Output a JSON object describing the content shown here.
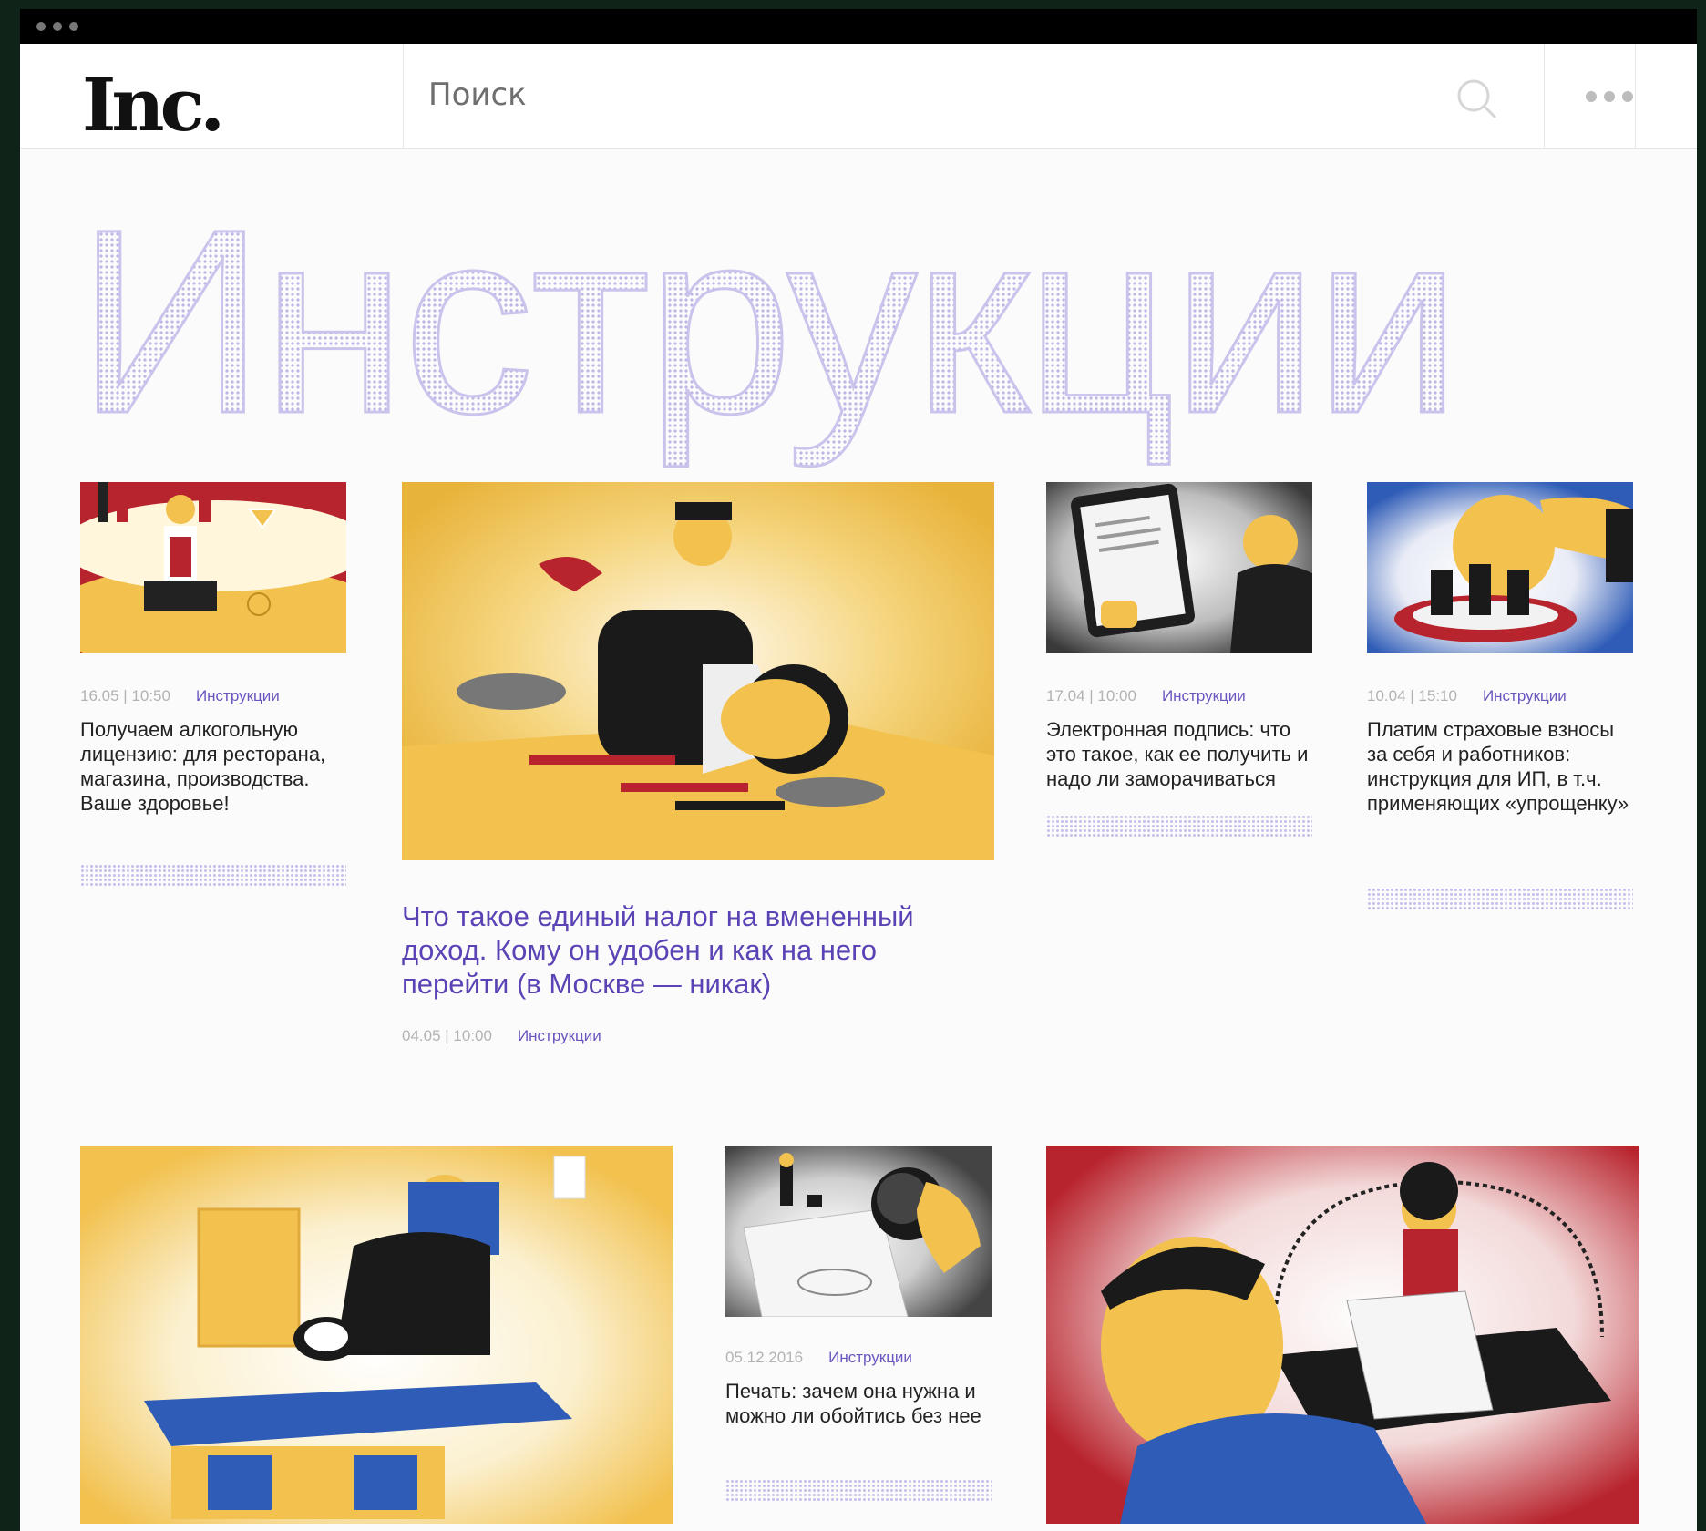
{
  "header": {
    "logo": "Inc.",
    "search_placeholder": "Поиск"
  },
  "hero": {
    "title": "Инструкции"
  },
  "articles": [
    {
      "date": "16.05 | 10:50",
      "category": "Инструкции",
      "title": "Получаем алкогольную лицензию: для ресторана, магазина, производства. Ваше здоровье!"
    },
    {
      "date": "04.05 | 10:00",
      "category": "Инструкции",
      "title": "Что такое единый налог на вмененный доход. Кому он удобен и как на него перейти (в Москве — никак)"
    },
    {
      "date": "17.04 | 10:00",
      "category": "Инструкции",
      "title": "Электронная подпись: что это такое, как ее получить и надо ли заморачиваться"
    },
    {
      "date": "10.04 | 15:10",
      "category": "Инструкции",
      "title": "Платим страховые взносы за себя и работников: инструкция для ИП, в т.ч. применяющих «упрощенку»"
    },
    {
      "date": "05.12.2016",
      "category": "Инструкции",
      "title": "Печать: зачем она нужна и можно ли обойтись без нее"
    }
  ],
  "colors": {
    "accent": "#5b43b5",
    "illus_yellow": "#f2c14e",
    "illus_red": "#b8242e",
    "illus_blue": "#2f5cb7",
    "page_bg": "#fbfbfb"
  }
}
